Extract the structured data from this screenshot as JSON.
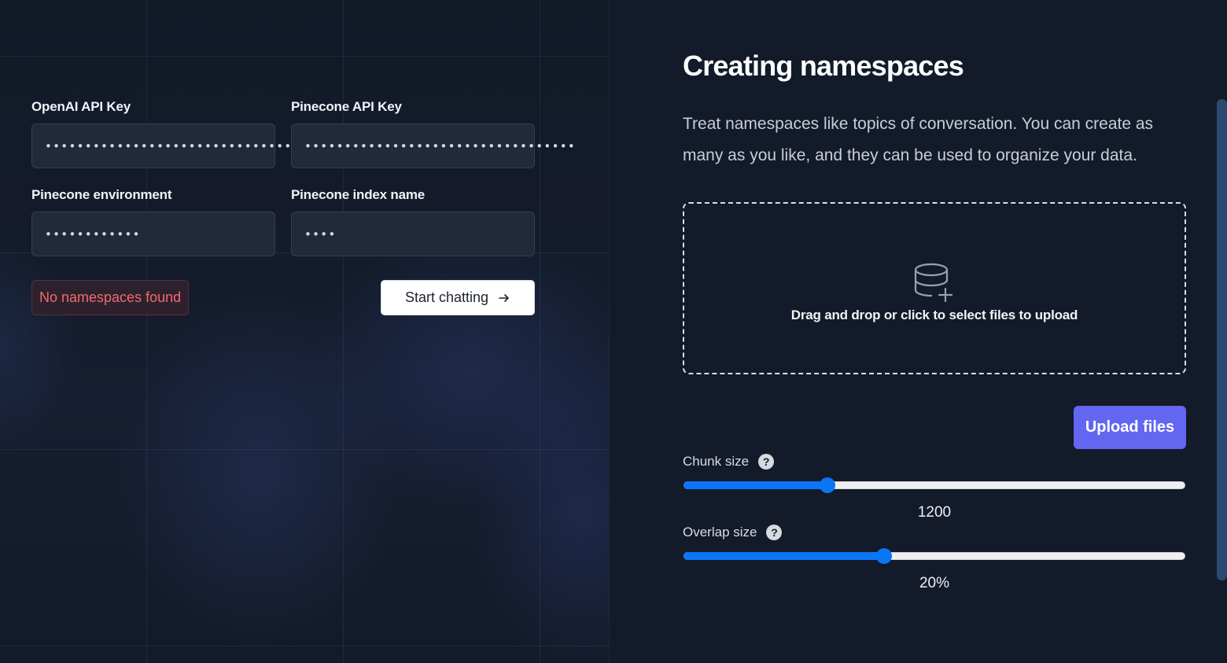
{
  "config_form": {
    "fields": [
      {
        "label": "OpenAI API Key",
        "value": "••••••••••••••••••••••••••••••••••",
        "type": "password"
      },
      {
        "label": "Pinecone API Key",
        "value": "••••••••••••••••••••••••••••••••••",
        "type": "password"
      },
      {
        "label": "Pinecone environment",
        "value": "••••••••••••",
        "type": "password"
      },
      {
        "label": "Pinecone index name",
        "value": "••••",
        "type": "password"
      }
    ],
    "error_message": "No namespaces found",
    "start_button_label": "Start chatting",
    "start_button_icon": "arrow-right-icon"
  },
  "namespace_panel": {
    "title": "Creating namespaces",
    "description": "Treat namespaces like topics of conversation. You can create as many as you like, and they can be used to organize your data.",
    "dropzone": {
      "icon": "database-plus-icon",
      "text": "Drag and drop or click to select files to upload"
    },
    "upload_button_label": "Upload files",
    "sliders": [
      {
        "label": "Chunk size",
        "help_icon": "question-circle-icon",
        "display_value": "1200",
        "fill_fraction": 0.287
      },
      {
        "label": "Overlap size",
        "help_icon": "question-circle-icon",
        "display_value": "20%",
        "fill_fraction": 0.4
      }
    ]
  },
  "colors": {
    "accent": "#6366f1",
    "slider_fill": "#0b76f5",
    "error_text": "#f16a6a",
    "background": "#131a29"
  }
}
